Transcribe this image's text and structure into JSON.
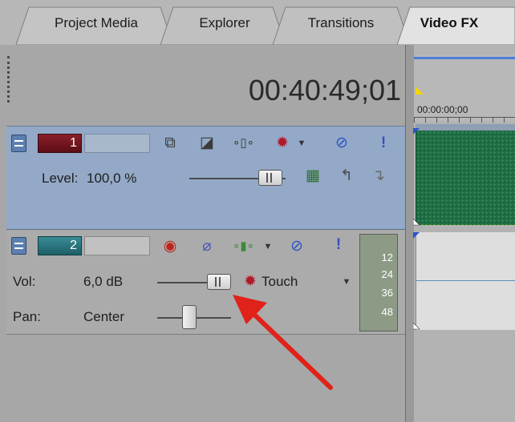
{
  "tabs": [
    "Project Media",
    "Explorer",
    "Transitions",
    "Video FX"
  ],
  "active_tab": "Video FX",
  "timecode": "00:40:49;01",
  "ruler_time": "00:00:00;00",
  "track1": {
    "number": "1",
    "level_label": "Level:",
    "level_value": "100,0 %",
    "icons": [
      "composite-mode-icon",
      "parent-overlay-icon",
      "motion-icon",
      "fx-gear-icon",
      "mute-icon",
      "solo-icon",
      "video-fx-icon",
      "make-parent-icon",
      "make-child-icon"
    ]
  },
  "track2": {
    "number": "2",
    "vol_label": "Vol:",
    "vol_value": "6,0 dB",
    "automation_mode": "Touch",
    "pan_label": "Pan:",
    "pan_value": "Center",
    "meter_ticks": [
      "12",
      "24",
      "36",
      "48"
    ]
  },
  "colors": {
    "track1_bg": "#93a9c7",
    "track1_number": "#8a1f2a",
    "track2_number": "#3a8b95",
    "arrow": "#e0221a",
    "clip_video": "#1d6e1d"
  }
}
